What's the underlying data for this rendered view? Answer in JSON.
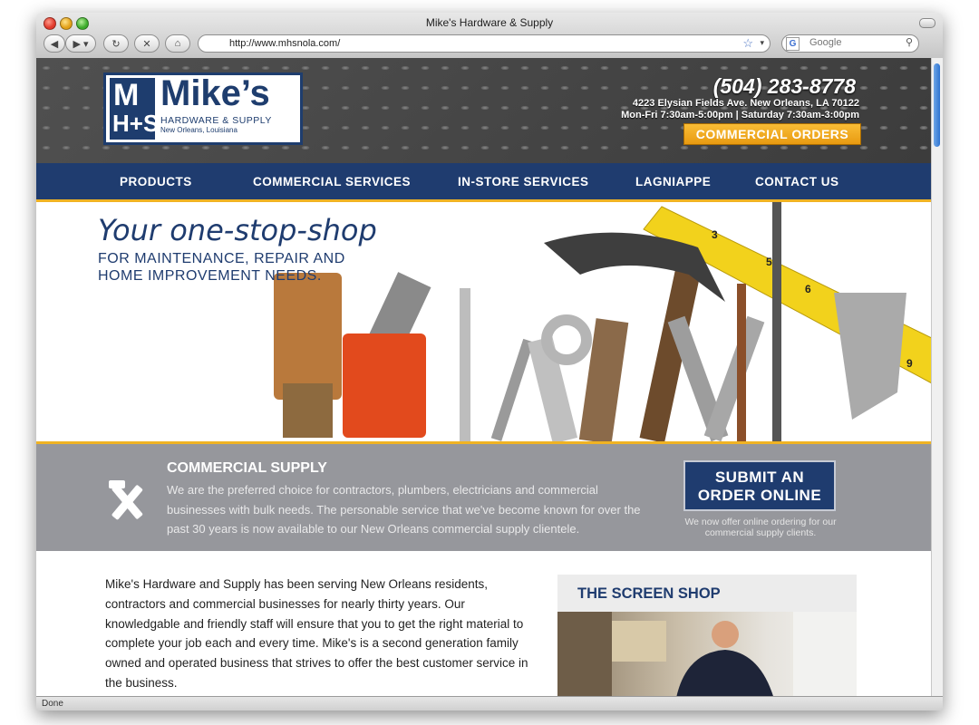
{
  "browser": {
    "window_title": "Mike's Hardware & Supply",
    "url": "http://www.mhsnola.com/",
    "search_placeholder": "Google",
    "status": "Done"
  },
  "header": {
    "logo": {
      "mark_m": "M",
      "mark_hs": "H+S",
      "name": "Mike’s",
      "subtitle": "HARDWARE & SUPPLY",
      "location": "New Orleans, Louisiana"
    },
    "phone": "(504) 283-8778",
    "address": "4223 Elysian Fields Ave. New Orleans, LA 70122",
    "hours": "Mon-Fri 7:30am-5:00pm  |  Saturday 7:30am-3:00pm",
    "cta": "COMMERCIAL ORDERS"
  },
  "nav": {
    "items": [
      {
        "label": "PRODUCTS"
      },
      {
        "label": "COMMERCIAL SERVICES"
      },
      {
        "label": "IN-STORE SERVICES"
      },
      {
        "label": "LAGNIAPPE"
      },
      {
        "label": "CONTACT US"
      }
    ]
  },
  "hero": {
    "title": "Your one-stop-shop",
    "subtitle": "FOR MAINTENANCE, REPAIR AND HOME IMPROVEMENT NEEDS."
  },
  "commercial": {
    "title": "COMMERCIAL SUPPLY",
    "text": "We are the preferred choice for contractors, plumbers, electricians and commercial businesses with bulk needs. The personable service that we've become known for over the past 30 years is now available to our New Orleans commercial supply clientele.",
    "button": "SUBMIT AN ORDER ONLINE",
    "note": "We now offer online ordering for our commercial supply clients."
  },
  "intro": {
    "text": "Mike's Hardware and Supply has been serving New Orleans residents, contractors and commercial businesses for nearly thirty years.  Our knowledgable and friendly staff will ensure that you to get the right material to complete your job each and every time.  Mike's is a second generation family owned and operated business that strives to offer the best customer service in the business."
  },
  "sidebar": {
    "screen_shop_title": "THE SCREEN SHOP"
  },
  "colors": {
    "navy": "#1f3c6f",
    "gold": "#f0b323",
    "gray_band": "#96979c"
  },
  "icons": [
    "back-icon",
    "forward-icon",
    "reload-icon",
    "stop-icon",
    "home-icon",
    "star-icon",
    "search-icon",
    "tools-icon"
  ]
}
